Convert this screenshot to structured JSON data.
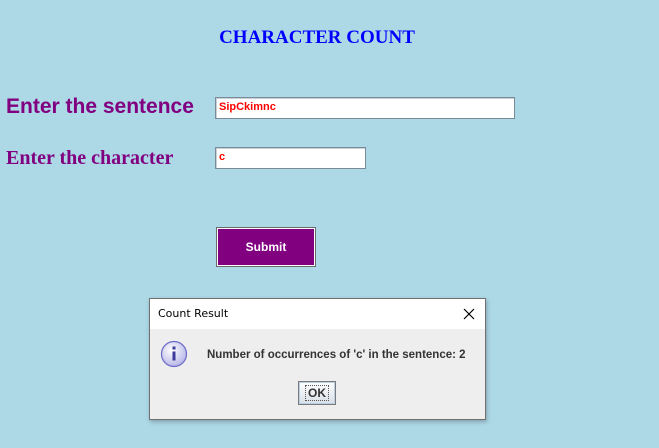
{
  "header": {
    "title": "CHARACTER COUNT"
  },
  "form": {
    "sentence_label": "Enter the sentence",
    "sentence_value": "SipCkimnc",
    "character_label": "Enter the character",
    "character_value": "c",
    "submit_label": "Submit"
  },
  "dialog": {
    "title": "Count Result",
    "message": "Number of occurrences of 'c' in the sentence: 2",
    "ok_label": "OK",
    "icon": "info-icon"
  },
  "colors": {
    "background": "#add8e6",
    "title": "#0000ff",
    "label": "#800080",
    "input_text": "#ff0000",
    "submit_bg": "#800080"
  }
}
